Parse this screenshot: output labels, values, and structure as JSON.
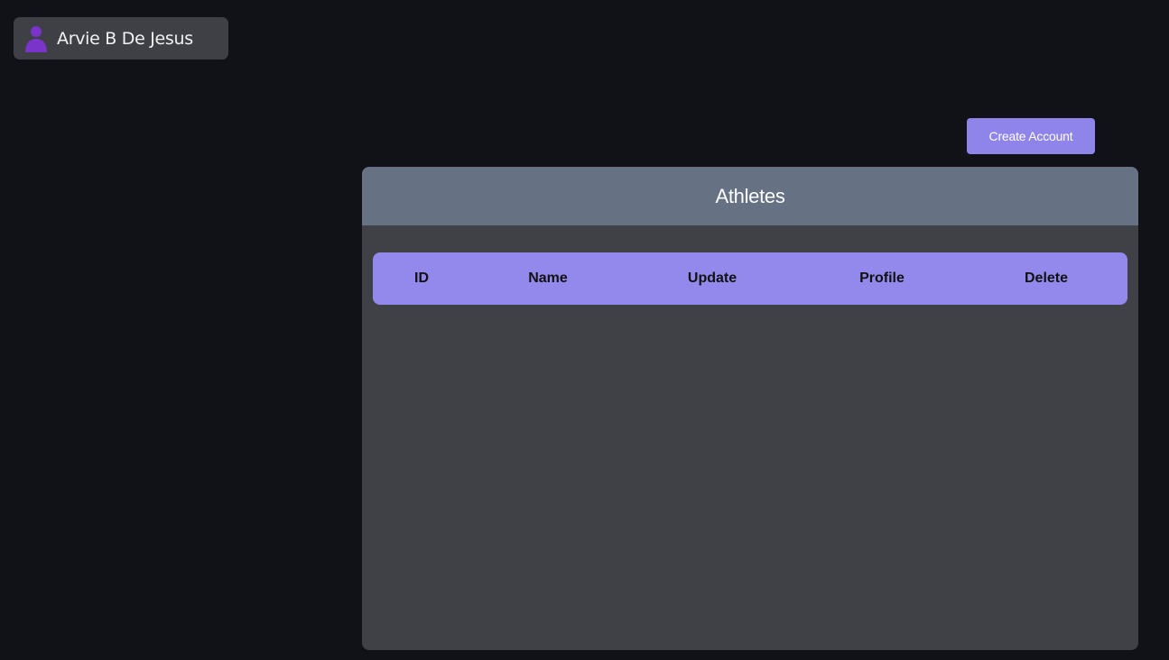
{
  "user": {
    "name": "Arvie B De Jesus",
    "icon": "user-icon",
    "icon_color": "#7b34c9"
  },
  "actions": {
    "create_account_label": "Create Account"
  },
  "athletes_panel": {
    "title": "Athletes",
    "columns": [
      "ID",
      "Name",
      "Update",
      "Profile",
      "Delete"
    ],
    "rows": []
  },
  "colors": {
    "background": "#111217",
    "accent": "#8f84e9",
    "panel": "#404146",
    "panel_header": "#667183"
  }
}
